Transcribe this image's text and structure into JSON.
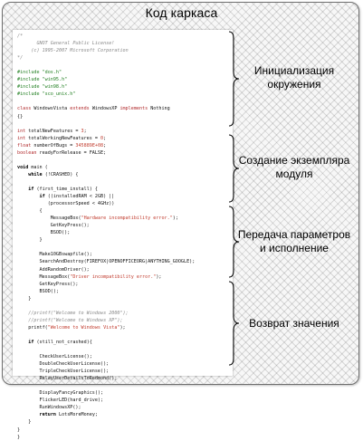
{
  "frame_title": "Код каркаса",
  "labels": {
    "env_init": [
      "Инициализация",
      "окружения"
    ],
    "module_create": [
      "Создание экземпляра",
      "модуля"
    ],
    "params_exec": [
      "Передача параметров",
      "и исполнение"
    ],
    "return_value": [
      "Возврат значения"
    ]
  },
  "code_lines": [
    "/*",
    "       GNOT General Public License!",
    "     (c) 1995-2007 Microsoft Corporation",
    "*/",
    "",
    "#include \"dos.h\"",
    "#include \"win95.h\"",
    "#include \"win98.h\"",
    "#include \"sco_unix.h\"",
    "",
    "class WindowsVista extends WindowsXP implements Nothing",
    "{}",
    "",
    "int totalNewFeatures = 3;",
    "int totalWorkingNewFeatures = 0;",
    "float numberOfBugs = 345889E+08;",
    "boolean readyForRelease = FALSE;",
    "",
    "void main (",
    "    while (!CRASHED) {",
    "",
    "    if (first_time_install) {",
    "        if ((installedRAM < 2GB) ||",
    "           (processorSpeed < 4GHz))",
    "        {",
    "            MessageBox(\"Hardware incompatibility error.\");",
    "            GetKeyPress();",
    "            BSOD();",
    "        }",
    "",
    "        Make10GBswapfile();",
    "        SearchAndDestroy(FIREFOX|OPENOFFICEORG|ANYTHING_GOOGLE);",
    "        AddRandomDriver();",
    "        MessageBox(\"Driver incompatibility error.\");",
    "        GetKeyPress();",
    "        BSOD();",
    "    }",
    "",
    "    //printf(\"Welcome to Windows 2000\");",
    "    //printf(\"Welcome to Windows XP\");",
    "    printf(\"Welcome to Windows Vista\");",
    "",
    "    if (still_not_crashed){",
    "",
    "        CheckUserLicense();",
    "        DoubleCheckUserLicense();",
    "        TripleCheckUserLicense();",
    "        RelayUserDetailsToRedmond();",
    "",
    "        DisplayFancyGraphics();",
    "        FlickerLED(hard_drive);",
    "        RunWindowsXP();",
    "        return LotsMoreMoney;",
    "    }",
    "}",
    "}"
  ],
  "colors": {
    "comment": "#8a8a8a",
    "preprocessor": "#1e7d1e",
    "string": "#c0392b",
    "frame_border": "#707070"
  }
}
